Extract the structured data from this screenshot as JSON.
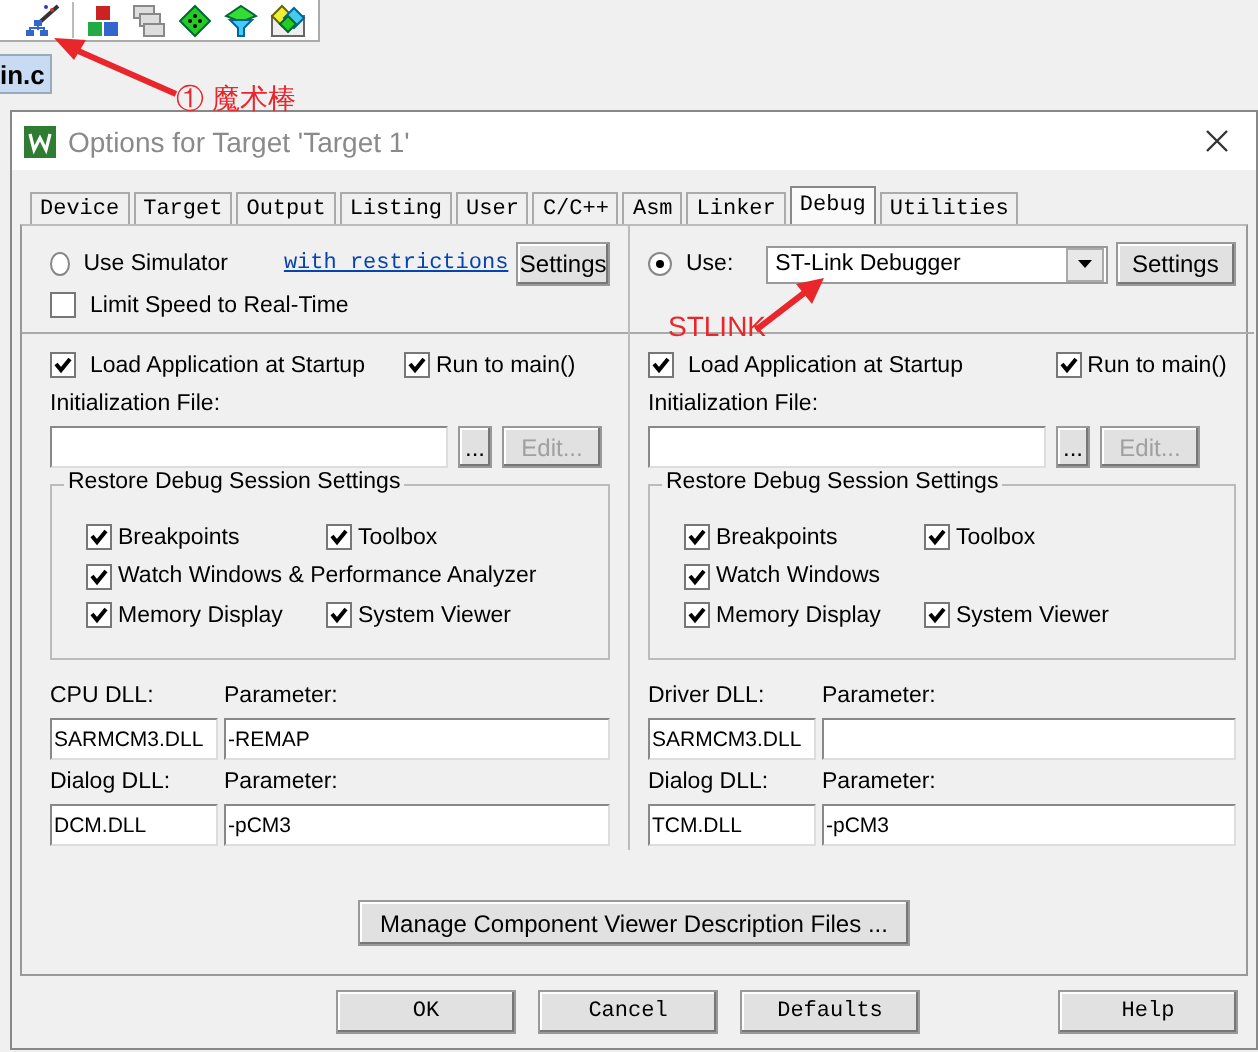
{
  "editor_tab": {
    "label": "in.c"
  },
  "annotations": [
    {
      "text": "① 魔术棒"
    },
    {
      "text": "STLINK"
    }
  ],
  "dialog": {
    "title": "Options for Target 'Target 1'",
    "tabs": [
      {
        "label": "Device",
        "selected": false
      },
      {
        "label": "Target",
        "selected": false
      },
      {
        "label": "Output",
        "selected": false
      },
      {
        "label": "Listing",
        "selected": false
      },
      {
        "label": "User",
        "selected": false
      },
      {
        "label": "C/C++",
        "selected": false
      },
      {
        "label": "Asm",
        "selected": false
      },
      {
        "label": "Linker",
        "selected": false
      },
      {
        "label": "Debug",
        "selected": true
      },
      {
        "label": "Utilities",
        "selected": false
      }
    ],
    "columns": [
      {
        "source": {
          "kind": "simulator",
          "label": "Use Simulator",
          "selected": false,
          "link": "with restrictions",
          "button": "Settings"
        },
        "limit_speed": {
          "label": "Limit Speed to Real-Time",
          "checked": false
        },
        "load_app": {
          "label": "Load Application at Startup",
          "checked": true
        },
        "run_to_main": {
          "label": "Run to main()",
          "checked": true
        },
        "init_label": "Initialization File:",
        "browse": "...",
        "edit": {
          "label": "Edit...",
          "disabled": true
        },
        "restore": {
          "title": "Restore Debug Session Settings",
          "rows": [
            [
              {
                "label": "Breakpoints",
                "checked": true
              },
              {
                "label": "Toolbox",
                "checked": true
              }
            ],
            [
              {
                "label": "Watch Windows & Performance Analyzer",
                "checked": true
              }
            ],
            [
              {
                "label": "Memory Display",
                "checked": true
              },
              {
                "label": "System Viewer",
                "checked": true
              }
            ]
          ]
        },
        "dlls": [
          {
            "label": "CPU DLL:",
            "value": "SARMCM3.DLL",
            "param_label": "Parameter:",
            "param": "-REMAP"
          },
          {
            "label": "Dialog DLL:",
            "value": "DCM.DLL",
            "param_label": "Parameter:",
            "param": "-pCM3"
          }
        ]
      },
      {
        "source": {
          "kind": "target",
          "label": "Use:",
          "selected": true,
          "value": "ST-Link Debugger",
          "button": "Settings"
        },
        "load_app": {
          "label": "Load Application at Startup",
          "checked": true
        },
        "run_to_main": {
          "label": "Run to main()",
          "checked": true
        },
        "init_label": "Initialization File:",
        "browse": "...",
        "edit": {
          "label": "Edit...",
          "disabled": true
        },
        "restore": {
          "title": "Restore Debug Session Settings",
          "rows": [
            [
              {
                "label": "Breakpoints",
                "checked": true
              },
              {
                "label": "Toolbox",
                "checked": true
              }
            ],
            [
              {
                "label": "Watch Windows",
                "checked": true
              }
            ],
            [
              {
                "label": "Memory Display",
                "checked": true
              },
              {
                "label": "System Viewer",
                "checked": true
              }
            ]
          ]
        },
        "dlls": [
          {
            "label": "Driver DLL:",
            "value": "SARMCM3.DLL",
            "param_label": "Parameter:"
          },
          {
            "label": "Dialog DLL:",
            "value": "TCM.DLL",
            "param_label": "Parameter:",
            "param": "-pCM3"
          }
        ]
      }
    ],
    "manage_button": "Manage Component Viewer Description Files ...",
    "buttons": [
      {
        "label": "OK",
        "kind": "main"
      },
      {
        "label": "Cancel",
        "kind": "main"
      },
      {
        "label": "Defaults",
        "kind": "main"
      },
      {
        "label": "Help",
        "kind": "help"
      }
    ]
  }
}
